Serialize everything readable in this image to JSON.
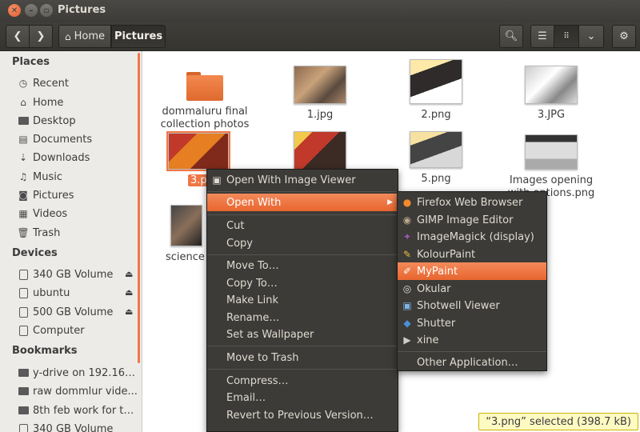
{
  "window": {
    "title": "Pictures"
  },
  "toolbar": {
    "breadcrumbs": [
      {
        "label": "Home",
        "icon": "home-icon"
      },
      {
        "label": "Pictures"
      }
    ]
  },
  "sidebar": {
    "sections": [
      {
        "heading": "Places",
        "items": [
          "Recent",
          "Home",
          "Desktop",
          "Documents",
          "Downloads",
          "Music",
          "Pictures",
          "Videos",
          "Trash"
        ]
      },
      {
        "heading": "Devices",
        "items": [
          "340 GB Volume",
          "ubuntu",
          "500 GB Volume",
          "Computer"
        ]
      },
      {
        "heading": "Bookmarks",
        "items": [
          "y-drive on 192.168....",
          "raw dommlur vide...",
          "8th feb work for th...",
          "340 GB Volume"
        ]
      }
    ]
  },
  "files": [
    {
      "name": "dommaluru final collection photos",
      "kind": "folder"
    },
    {
      "name": "1.jpg"
    },
    {
      "name": "2.png"
    },
    {
      "name": "3.JPG"
    },
    {
      "name": "3.p",
      "selected": true
    },
    {
      "name": "5.png"
    },
    {
      "name": "Images opening with options.png"
    },
    {
      "name": "science l"
    }
  ],
  "context_menu": {
    "items": [
      "Open With Image Viewer",
      "Open With",
      "Cut",
      "Copy",
      "Move To…",
      "Copy To…",
      "Make Link",
      "Rename…",
      "Set as Wallpaper",
      "Move to Trash",
      "Compress…",
      "Email…",
      "Revert to Previous Version…"
    ]
  },
  "submenu": {
    "items": [
      "Firefox Web Browser",
      "GIMP Image Editor",
      "ImageMagick (display)",
      "KolourPaint",
      "MyPaint",
      "Okular",
      "Shotwell Viewer",
      "Shutter",
      "xine",
      "Other Application…"
    ],
    "highlighted": "MyPaint"
  },
  "status": {
    "text": "“3.png” selected  (398.7 kB)"
  },
  "colors": {
    "accent": "#f07746",
    "menu_bg": "#3c3b37",
    "sidebar_bg": "#edebe8"
  }
}
